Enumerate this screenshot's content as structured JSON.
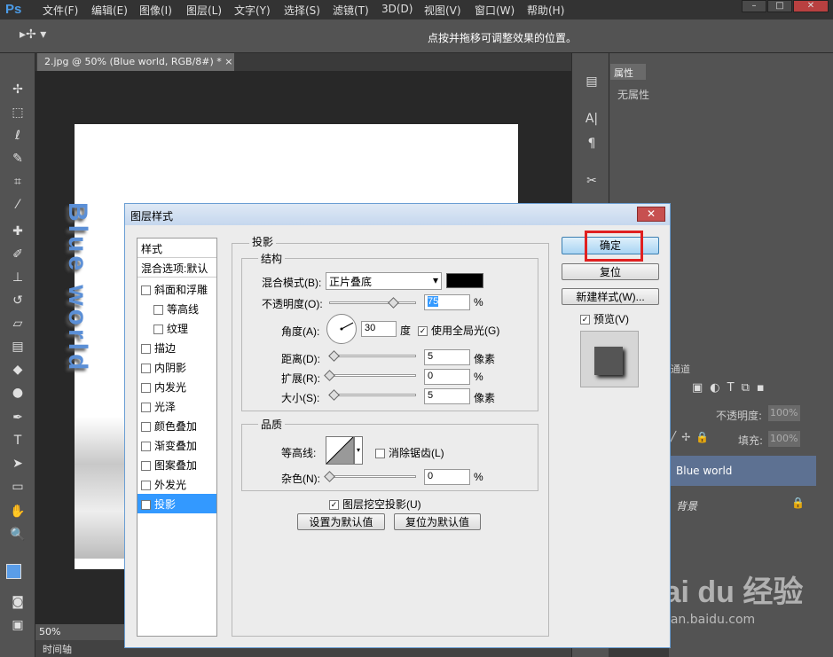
{
  "menubar": {
    "logo": "Ps",
    "items": [
      "文件(F)",
      "编辑(E)",
      "图像(I)",
      "图层(L)",
      "文字(Y)",
      "选择(S)",
      "滤镜(T)",
      "3D(D)",
      "视图(V)",
      "窗口(W)",
      "帮助(H)"
    ],
    "min": "–",
    "max": "□",
    "close": "✕"
  },
  "optbar": {
    "hint": "点按并拖移可调整效果的位置。"
  },
  "document": {
    "tab": "2.jpg @ 50% (Blue world, RGB/8#) *",
    "tab_close": "×",
    "canvas_text": "Blue world",
    "zoom": "50%",
    "timeline": "时间轴"
  },
  "properties": {
    "tab": "属性",
    "empty": "无属性"
  },
  "layers": {
    "channels_tab": "通道",
    "opacity_label": "不透明度:",
    "opacity": "100%",
    "fill_label": "填充:",
    "fill": "100%",
    "layer1": "Blue world",
    "layer2": "背景"
  },
  "dialog": {
    "title": "图层样式",
    "close": "✕",
    "styles": {
      "header": "样式",
      "blend": "混合选项:默认",
      "items": [
        "斜面和浮雕",
        "等高线",
        "纹理",
        "描边",
        "内阴影",
        "内发光",
        "光泽",
        "颜色叠加",
        "渐变叠加",
        "图案叠加",
        "外发光",
        "投影"
      ]
    },
    "section": "投影",
    "structure": {
      "title": "结构",
      "blend_label": "混合模式(B):",
      "blend_value": "正片叠底",
      "opacity_label": "不透明度(O):",
      "opacity_value": "75",
      "pct": "%",
      "angle_label": "角度(A):",
      "angle_value": "30",
      "deg": "度",
      "global_light": "使用全局光(G)",
      "distance_label": "距离(D):",
      "distance_value": "5",
      "px": "像素",
      "spread_label": "扩展(R):",
      "spread_value": "0",
      "size_label": "大小(S):",
      "size_value": "5"
    },
    "quality": {
      "title": "品质",
      "contour_label": "等高线:",
      "antialias": "消除锯齿(L)",
      "noise_label": "杂色(N):",
      "noise_value": "0"
    },
    "knockout": "图层挖空投影(U)",
    "set_default": "设置为默认值",
    "reset_default": "复位为默认值",
    "ok": "确定",
    "reset": "复位",
    "new_style": "新建样式(W)...",
    "preview": "预览(V)",
    "shadow_color": "#000000"
  },
  "watermark": {
    "brand": "Bai du 经验",
    "url": "jingyan.baidu.com"
  }
}
